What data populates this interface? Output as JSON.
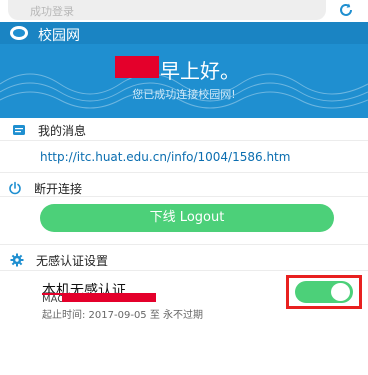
{
  "topbar": {
    "url_text": "成功登录"
  },
  "header": {
    "app_title": "校园网",
    "greeting": "早上好。",
    "subtitle": "您已成功连接校园网!"
  },
  "messages": {
    "title": "我的消息",
    "link": "http://itc.huat.edu.cn/info/1004/1586.htm"
  },
  "disconnect": {
    "title": "断开连接",
    "button_label": "下线 Logout"
  },
  "auth_settings": {
    "title": "无感认证设置",
    "device_name": "本机无感认证",
    "mac_label": "MAC:",
    "time_text": "起止时间: 2017-09-05 至 永不过期",
    "toggle_on": true
  },
  "colors": {
    "header": "#1f8fd0",
    "accent_green": "#4cd079",
    "link": "#0b6eb0",
    "highlight_red": "#e8201f"
  }
}
